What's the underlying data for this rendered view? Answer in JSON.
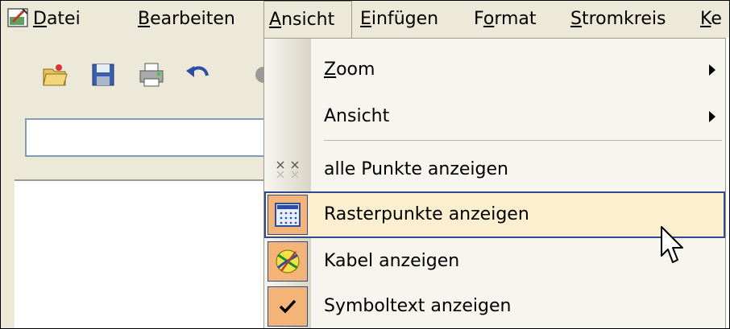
{
  "menubar": {
    "items": [
      {
        "pre": "",
        "u": "D",
        "post": "atei"
      },
      {
        "pre": "",
        "u": "B",
        "post": "earbeiten"
      },
      {
        "pre": "",
        "u": "A",
        "post": "nsicht"
      },
      {
        "pre": "",
        "u": "E",
        "post": "infügen"
      },
      {
        "pre": "F",
        "u": "o",
        "post": "rmat"
      },
      {
        "pre": "",
        "u": "S",
        "post": "tromkreis"
      },
      {
        "pre": "",
        "u": "K",
        "post": "e"
      }
    ]
  },
  "toolbar": {
    "icons": [
      "open-icon",
      "save-icon",
      "print-icon",
      "undo-icon"
    ]
  },
  "address": {
    "value": ""
  },
  "dropdown": {
    "items": [
      {
        "u": "Z",
        "post": "oom",
        "submenu": true
      },
      {
        "u": "",
        "post": "Ansicht",
        "submenu": true
      },
      {
        "u": "",
        "post": "alle Punkte anzeigen",
        "icon": "dots-grid-icon"
      },
      {
        "u": "",
        "post": "Rasterpunkte anzeigen",
        "icon": "raster-grid-icon",
        "highlighted": true,
        "checked": true
      },
      {
        "u": "",
        "post": "Kabel anzeigen",
        "icon": "cable-icon",
        "checked": true
      },
      {
        "u": "",
        "post": "Symboltext anzeigen",
        "icon": "checkmark-icon",
        "checked": true
      }
    ]
  },
  "colors": {
    "menu_bg": "#ece9d8",
    "highlight_bg": "#fcefcf",
    "highlight_border": "#2e4b8b",
    "checked_bg": "#f4b478"
  }
}
